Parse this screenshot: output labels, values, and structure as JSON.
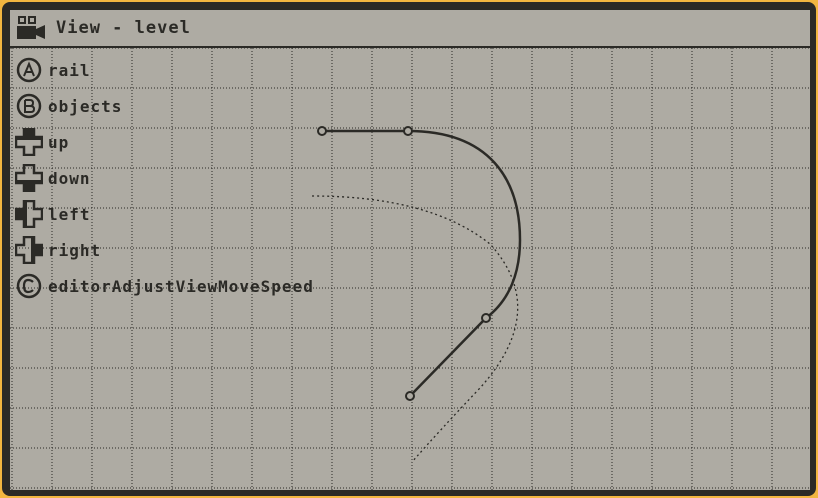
{
  "window": {
    "title": "View - level",
    "title_icon": "camera-icon"
  },
  "legend": {
    "items": [
      {
        "key": "a",
        "icon": "button-a-icon",
        "label": "rail"
      },
      {
        "key": "b",
        "icon": "button-b-icon",
        "label": "objects"
      },
      {
        "key": "up",
        "icon": "dpad-up-icon",
        "label": "up"
      },
      {
        "key": "down",
        "icon": "dpad-down-icon",
        "label": "down"
      },
      {
        "key": "left",
        "icon": "dpad-left-icon",
        "label": "left"
      },
      {
        "key": "right",
        "icon": "dpad-right-icon",
        "label": "right"
      },
      {
        "key": "c",
        "icon": "button-c-icon",
        "label": "editorAdjustViewMoveSpeed"
      }
    ]
  },
  "colors": {
    "screen_bg": "#aeaba3",
    "ink": "#2b2a26",
    "frame_accent": "#f2b640"
  }
}
